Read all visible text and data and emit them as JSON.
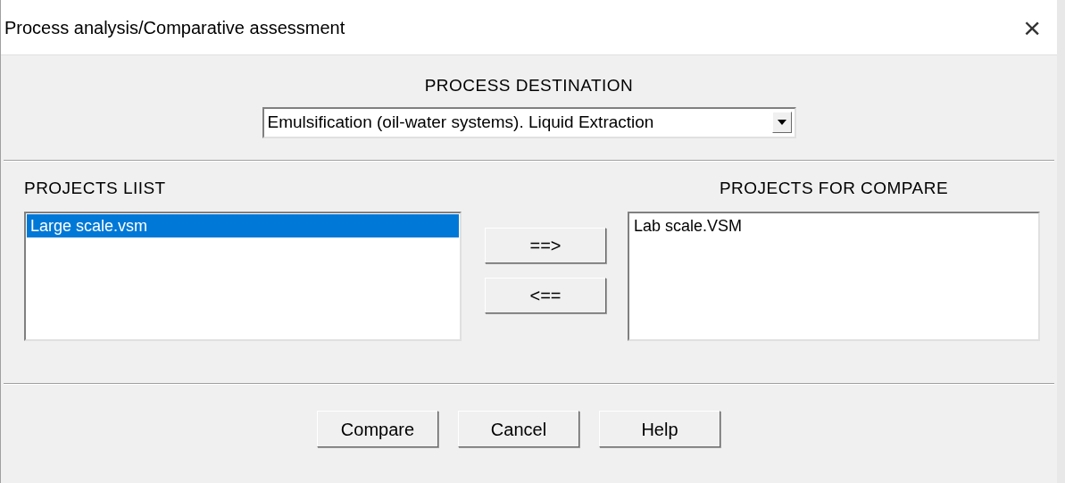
{
  "window": {
    "title": "Process analysis/Comparative assessment",
    "close": "×"
  },
  "destination": {
    "label": "PROCESS DESTINATION",
    "value": "Emulsification (oil-water systems). Liquid Extraction"
  },
  "projects_list": {
    "label": "PROJECTS LIIST",
    "items": [
      {
        "name": "Large scale.vsm",
        "selected": true
      }
    ]
  },
  "move_buttons": [
    "==>",
    "<=="
  ],
  "projects_for_compare": {
    "label": "PROJECTS FOR COMPARE",
    "items": [
      {
        "name": "Lab scale.VSM",
        "selected": false
      }
    ]
  },
  "buttons": [
    "Compare",
    "Cancel",
    "Help"
  ]
}
